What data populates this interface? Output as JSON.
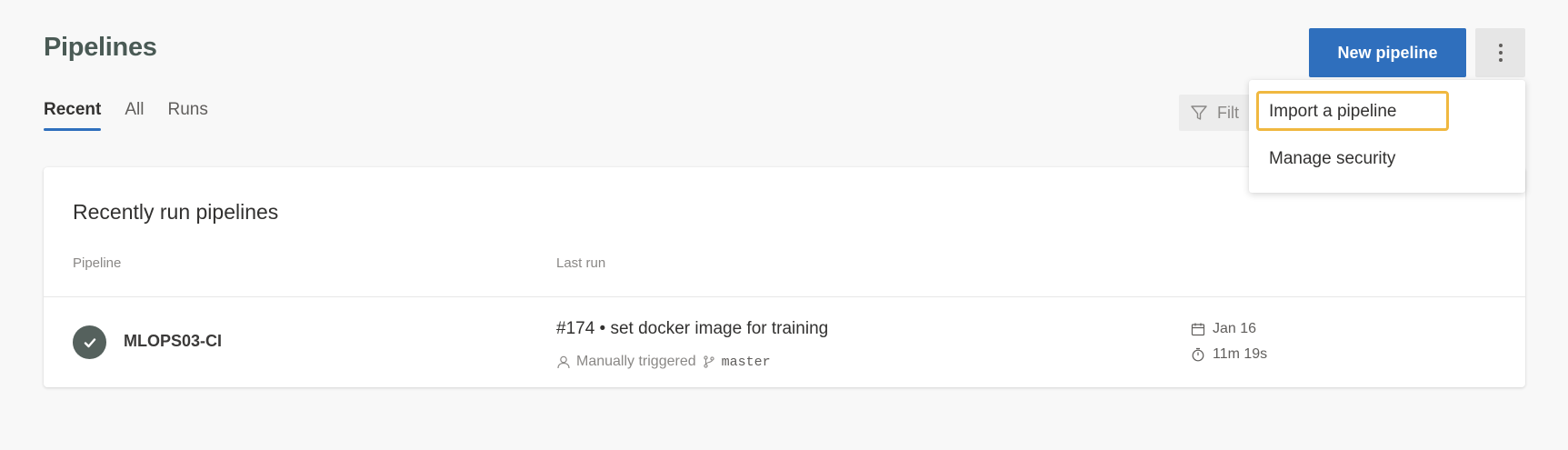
{
  "page": {
    "title": "Pipelines"
  },
  "tabs": [
    {
      "label": "Recent",
      "active": true
    },
    {
      "label": "All",
      "active": false
    },
    {
      "label": "Runs",
      "active": false
    }
  ],
  "toolbar": {
    "new_pipeline_label": "New pipeline",
    "filter_placeholder": "Filt"
  },
  "menu": {
    "items": [
      {
        "label": "Import a pipeline",
        "highlighted": true
      },
      {
        "label": "Manage security",
        "highlighted": false
      }
    ]
  },
  "card": {
    "title": "Recently run pipelines",
    "columns": {
      "pipeline": "Pipeline",
      "last_run": "Last run"
    },
    "rows": [
      {
        "name": "MLOPS03-CI",
        "status_icon": "check-circle-icon",
        "run_title": "#174 • set docker image for training",
        "trigger": "Manually triggered",
        "branch": "master",
        "date": "Jan 16",
        "duration": "11m 19s"
      }
    ]
  },
  "colors": {
    "primary": "#2f6fbd",
    "highlight": "#f0b840",
    "status": "#55615d"
  }
}
